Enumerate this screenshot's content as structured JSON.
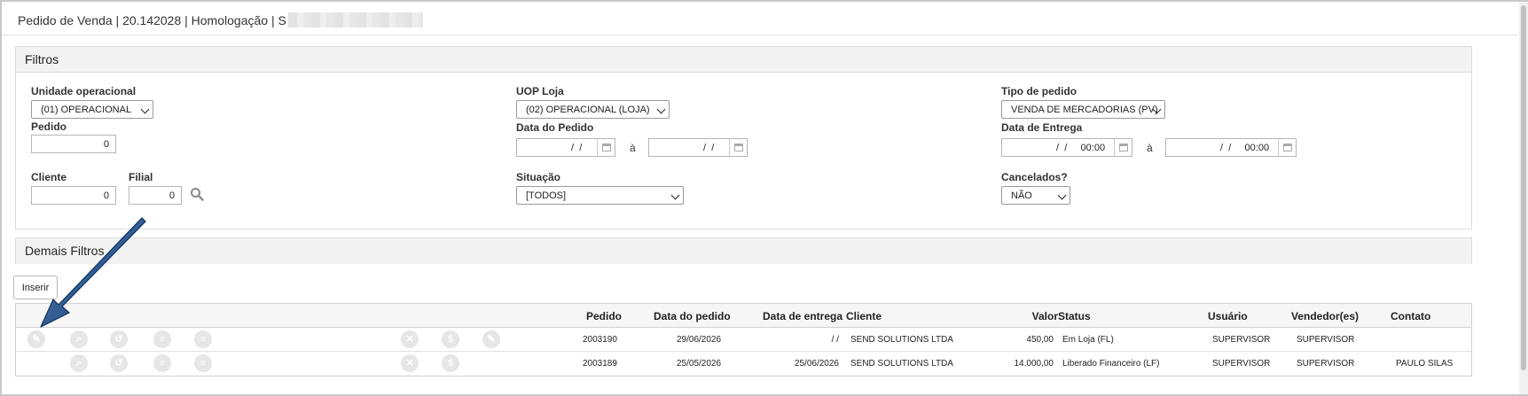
{
  "header": {
    "title": "Pedido de Venda | 20.142028 | Homologação | S"
  },
  "filtros": {
    "title": "Filtros",
    "unidade_operacional": {
      "label": "Unidade operacional",
      "value": "(01) OPERACIONAL"
    },
    "uop_loja": {
      "label": "UOP Loja",
      "value": "(02) OPERACIONAL (LOJA)"
    },
    "tipo_pedido": {
      "label": "Tipo de pedido",
      "value": "VENDA DE MERCADORIAS (PV)"
    },
    "pedido": {
      "label": "Pedido",
      "value": "0"
    },
    "data_pedido": {
      "label": "Data do Pedido",
      "from": " /  / ",
      "to": " /  / ",
      "separator": "à"
    },
    "data_entrega": {
      "label": "Data de Entrega",
      "from": " /  /     00:00",
      "to": " /  /     00:00",
      "separator": "à"
    },
    "cliente": {
      "label": "Cliente",
      "value": "0"
    },
    "filial": {
      "label": "Filial",
      "value": "0"
    },
    "situacao": {
      "label": "Situação",
      "value": "[TODOS]"
    },
    "cancelados": {
      "label": "Cancelados?",
      "value": "NÃO"
    }
  },
  "demais_filtros": {
    "title": "Demais Filtros"
  },
  "toolbar": {
    "insert_label": "Inserir"
  },
  "table": {
    "headers": {
      "pedido": "Pedido",
      "data_pedido": "Data do pedido",
      "data_entrega": "Data de entrega",
      "cliente": "Cliente",
      "valor": "Valor",
      "status": "Status",
      "usuario": "Usuário",
      "vendedores": "Vendedor(es)",
      "contato": "Contato"
    },
    "rows": [
      {
        "pedido": "2003190",
        "data_pedido": "29/06/2026",
        "data_entrega": "/ /",
        "cliente": "SEND SOLUTIONS LTDA",
        "valor": "450,00",
        "status": "Em Loja (FL)",
        "usuario": "SUPERVISOR",
        "vendedores": "SUPERVISOR",
        "contato": ""
      },
      {
        "pedido": "2003189",
        "data_pedido": "25/05/2026",
        "data_entrega": "25/06/2026",
        "cliente": "SEND SOLUTIONS LTDA",
        "valor": "14.000,00",
        "status": "Liberado Financeiro (LF)",
        "usuario": "SUPERVISOR",
        "vendedores": "SUPERVISOR",
        "contato": "PAULO SILAS"
      }
    ]
  },
  "icons": {
    "row_actions": [
      "pencil-icon",
      "search-icon",
      "history-icon",
      "list-icon",
      "menu-icon",
      "cancel-icon",
      "dollar-icon",
      "edit-icon"
    ],
    "annotation": "arrow-annotation",
    "arrow_color": "#123f72"
  }
}
